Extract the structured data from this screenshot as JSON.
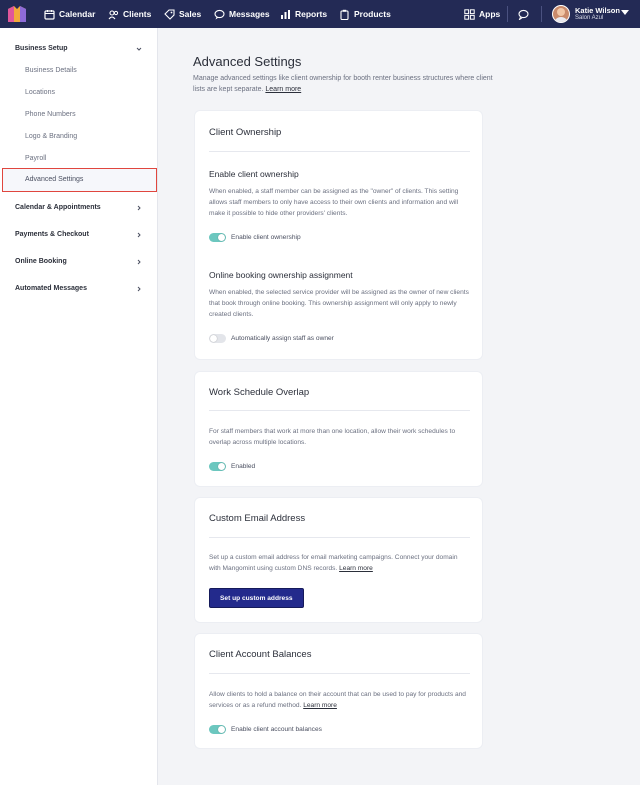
{
  "nav": {
    "items": [
      {
        "label": "Calendar",
        "icon": "calendar-icon"
      },
      {
        "label": "Clients",
        "icon": "clients-icon"
      },
      {
        "label": "Sales",
        "icon": "tag-icon"
      },
      {
        "label": "Messages",
        "icon": "chat-icon"
      },
      {
        "label": "Reports",
        "icon": "bar-chart-icon"
      },
      {
        "label": "Products",
        "icon": "clipboard-icon"
      }
    ],
    "apps_label": "Apps",
    "user": {
      "name": "Katie Wilson",
      "org": "Salon Azul"
    }
  },
  "sidebar": {
    "business_setup": "Business Setup",
    "items": [
      "Business Details",
      "Locations",
      "Phone Numbers",
      "Logo & Branding",
      "Payroll",
      "Advanced Settings"
    ],
    "sections": [
      "Calendar & Appointments",
      "Payments & Checkout",
      "Online Booking",
      "Automated Messages"
    ]
  },
  "main": {
    "title": "Advanced Settings",
    "description": "Manage advanced settings like client ownership for booth renter business structures where client lists are kept separate.",
    "learn_more": "Learn more"
  },
  "cards": {
    "client_ownership": {
      "title": "Client Ownership",
      "enable_title": "Enable client ownership",
      "enable_desc": "When enabled, a staff member can be assigned as the \"owner\" of clients. This setting allows staff members to only have access to their own clients and information and will make it possible to hide other providers' clients.",
      "enable_toggle_label": "Enable client ownership",
      "enable_toggle_on": true,
      "booking_title": "Online booking ownership assignment",
      "booking_desc": "When enabled, the selected service provider will be assigned as the owner of new clients that book through online booking. This ownership assignment will only apply to newly created clients.",
      "booking_toggle_label": "Automatically assign staff as owner",
      "booking_toggle_on": false
    },
    "work_schedule": {
      "title": "Work Schedule Overlap",
      "desc": "For staff members that work at more than one location, allow their work schedules to overlap across multiple locations.",
      "toggle_label": "Enabled",
      "toggle_on": true
    },
    "custom_email": {
      "title": "Custom Email Address",
      "desc": "Set up a custom email address for email marketing campaigns. Connect your domain with Mangomint using custom DNS records.",
      "learn_more": "Learn more",
      "button": "Set up custom address"
    },
    "account_balances": {
      "title": "Client Account Balances",
      "desc": "Allow clients to hold a balance on their account that can be used to pay for products and services or as a refund method.",
      "learn_more": "Learn more",
      "toggle_label": "Enable client account balances",
      "toggle_on": true
    }
  },
  "colors": {
    "nav_bg": "#232a55",
    "toggle_on": "#6cc7bf",
    "primary_button": "#232a8c",
    "highlight_border": "#e0463e"
  }
}
